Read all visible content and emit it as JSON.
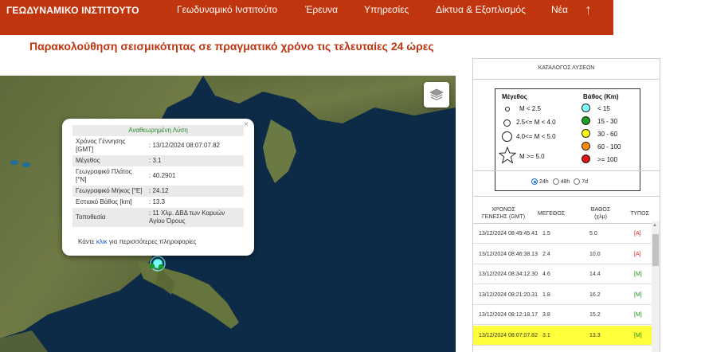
{
  "header": {
    "brand": "ΓΕΩΔΥΝΑΜΙΚΟ ΙΝΣΤΙΤΟΥΤΟ",
    "nav": [
      "Γεωδυναμικό Ινστιτούτο",
      "Έρευνα",
      "Υπηρεσίες",
      "Δίκτυα & Εξοπλισμός",
      "Νέα"
    ],
    "scroll_top_icon": "arrow-up-icon"
  },
  "page": {
    "title": "Παρακολούθηση σεισμικότητας σε πραγματικό χρόνο τις τελευταίες 24 ώρες"
  },
  "map": {
    "layers_icon": "layers-icon",
    "popup": {
      "header": "Αναθεωρημένη Λύση",
      "rows": [
        {
          "label": "Χρόνος Γέννησης [GMT]",
          "value": ": 13/12/2024 08:07:07.82"
        },
        {
          "label": "Μέγεθος",
          "value": ": 3.1"
        },
        {
          "label": "Γεωγραφικό Πλάτος [°N]",
          "value": ": 40.2901"
        },
        {
          "label": "Γεωγραφικό Μήκος [°E]",
          "value": ": 24.12"
        },
        {
          "label": "Εστιακό Βάθος [km]",
          "value": ": 13.3"
        },
        {
          "label": "Τοποθεσία",
          "value": ": 11 Χλμ. ΔΒΔ των Καρυών Αγίου Όρους"
        }
      ],
      "more_prefix": "Κάντε ",
      "more_link": "κλικ",
      "more_suffix": " για περισσότερες πληροφορίες",
      "close": "×"
    }
  },
  "panel": {
    "title": "ΚΑΤΑΛΟΓΟΣ ΛΥΣΕΩΝ",
    "legend": {
      "magnitude_title": "Μέγεθος",
      "magnitude_items": [
        "M < 2.5",
        "2.5<= M < 4.0",
        "4.0<= M < 5.0",
        "M >= 5.0"
      ],
      "depth_title": "Βάθος (Km)",
      "depth_items": [
        {
          "label": "< 15",
          "color": "#7fffff"
        },
        {
          "label": "15 - 30",
          "color": "#1e9e1e"
        },
        {
          "label": "30 - 60",
          "color": "#ffff00"
        },
        {
          "label": "60 - 100",
          "color": "#ff8c00"
        },
        {
          "label": ">= 100",
          "color": "#e61010"
        }
      ]
    },
    "periods": [
      {
        "label": "24h",
        "checked": true
      },
      {
        "label": "48h",
        "checked": false
      },
      {
        "label": "7d",
        "checked": false
      }
    ],
    "columns": {
      "time_line1": "ΧΡΟΝΟΣ",
      "time_line2": "ΓΕΝΕΣΗΣ (GMT)",
      "magnitude": "ΜΕΓΕΘΟΣ",
      "depth_line1": "ΒΑΘΟΣ",
      "depth_line2": "(χλμ)",
      "type": "ΤΥΠΟΣ"
    },
    "rows": [
      {
        "time": "13/12/2024 08:49:45.41",
        "mag": "1.5",
        "depth": "5.0",
        "type": "[A]"
      },
      {
        "time": "13/12/2024 08:46:38.13",
        "mag": "2.4",
        "depth": "10.0",
        "type": "[A]"
      },
      {
        "time": "13/12/2024 08:34:12.30",
        "mag": "4.6",
        "depth": "14.4",
        "type": "[M]"
      },
      {
        "time": "13/12/2024 08:21:20.31",
        "mag": "1.8",
        "depth": "16.2",
        "type": "[M]"
      },
      {
        "time": "13/12/2024 08:12:18.17",
        "mag": "3.8",
        "depth": "15.2",
        "type": "[M]"
      },
      {
        "time": "13/12/2024 08:07:07.82",
        "mag": "3.1",
        "depth": "13.3",
        "type": "[M]"
      }
    ],
    "colors": {
      "auto": "#d62020",
      "manual": "#1e8c1e",
      "highlight": "#ffff3c"
    }
  }
}
